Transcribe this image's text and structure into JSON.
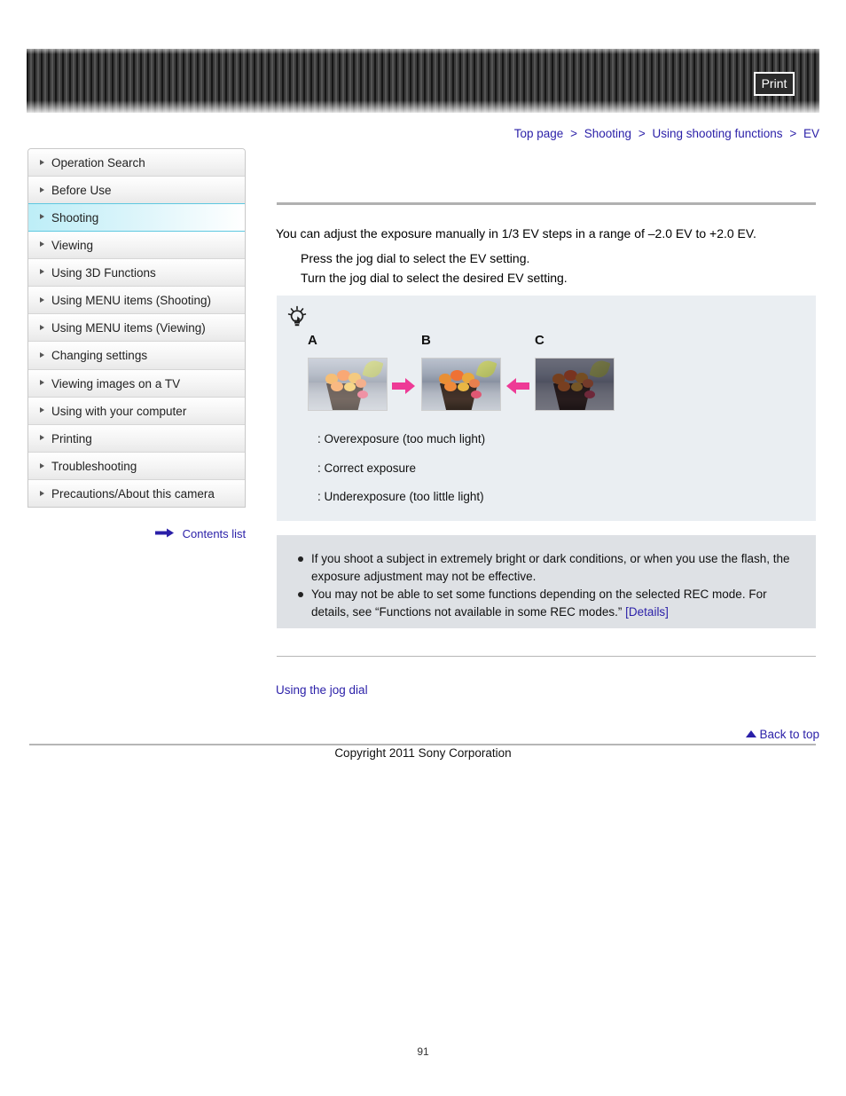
{
  "header": {
    "print_label": "Print"
  },
  "breadcrumb": {
    "items": [
      "Top page",
      "Shooting",
      "Using shooting functions",
      "EV"
    ],
    "separator": ">"
  },
  "sidebar": {
    "items": [
      {
        "label": "Operation Search",
        "selected": false
      },
      {
        "label": "Before Use",
        "selected": false
      },
      {
        "label": "Shooting",
        "selected": true
      },
      {
        "label": "Viewing",
        "selected": false
      },
      {
        "label": "Using 3D Functions",
        "selected": false
      },
      {
        "label": "Using MENU items (Shooting)",
        "selected": false
      },
      {
        "label": "Using MENU items (Viewing)",
        "selected": false
      },
      {
        "label": "Changing settings",
        "selected": false
      },
      {
        "label": "Viewing images on a TV",
        "selected": false
      },
      {
        "label": "Using with your computer",
        "selected": false
      },
      {
        "label": "Printing",
        "selected": false
      },
      {
        "label": "Troubleshooting",
        "selected": false
      },
      {
        "label": "Precautions/About this camera",
        "selected": false
      }
    ],
    "contents_list_label": "Contents list"
  },
  "main": {
    "intro": "You can adjust the exposure manually in 1/3 EV steps in a range of –2.0 EV to +2.0 EV.",
    "step_1": "Press the jog dial to select the EV setting.",
    "step_2": "Turn the jog dial to select the desired EV setting.",
    "tip": {
      "photo_labels": {
        "a": "A",
        "b": "B",
        "c": "C"
      },
      "captions": {
        "a": ": Overexposure (too much light)",
        "b": ": Correct exposure",
        "c": ": Underexposure (too little light)"
      }
    },
    "notes": [
      {
        "text": "If you shoot a subject in extremely bright or dark conditions, or when you use the flash, the exposure adjustment may not be effective.",
        "link": ""
      },
      {
        "text": "You may not be able to set some functions depending on the selected REC mode. For details, see “Functions not available in some REC modes.” ",
        "link": "[Details]"
      }
    ]
  },
  "footer": {
    "related_link": "Using the jog dial",
    "back_to_top": "Back to top",
    "copyright": "Copyright 2011 Sony Corporation",
    "page_number": "91"
  },
  "colors": {
    "link": "#2a1fa8",
    "selected_nav": "#bdeef7",
    "selected_nav_border": "#5ec8e0",
    "tip_box_bg": "#eaeef2",
    "note_box_bg": "#dee1e5",
    "arrow_pink": "#ee3a96",
    "header_bg": "#2e2e2e"
  }
}
